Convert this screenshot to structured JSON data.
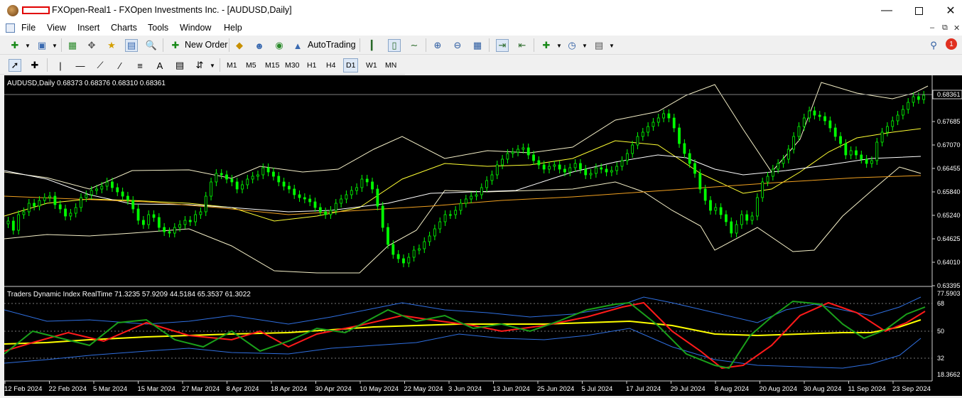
{
  "window": {
    "title": "FXOpen-Real1 - FXOpen Investments Inc. - [AUDUSD,Daily]",
    "minimize_icon": "minimize-icon",
    "maximize_icon": "maximize-icon",
    "close_icon": "close-icon"
  },
  "menu": {
    "items": [
      "File",
      "View",
      "Insert",
      "Charts",
      "Tools",
      "Window",
      "Help"
    ],
    "mdi_minimize": "–",
    "mdi_restore": "⧉",
    "mdi_close": "✕"
  },
  "toolbar1": {
    "new_order": "New Order",
    "auto_trading": "AutoTrading",
    "notification_count": "1"
  },
  "toolbar2": {
    "timeframes": [
      "M1",
      "M5",
      "M15",
      "M30",
      "H1",
      "H4",
      "D1",
      "W1",
      "MN"
    ],
    "active_timeframe": "D1"
  },
  "chart": {
    "header": "AUDUSD,Daily  0.68373 0.68376 0.68310 0.68361",
    "current_price": "0.68361",
    "price_ticks": [
      "0.67685",
      "0.67070",
      "0.66455",
      "0.65840",
      "0.65240",
      "0.64625",
      "0.64010",
      "0.63395"
    ],
    "x_labels": [
      "12 Feb 2024",
      "22 Feb 2024",
      "5 Mar 2024",
      "15 Mar 2024",
      "27 Mar 2024",
      "8 Apr 2024",
      "18 Apr 2024",
      "30 Apr 2024",
      "10 May 2024",
      "22 May 2024",
      "3 Jun 2024",
      "13 Jun 2024",
      "25 Jun 2024",
      "5 Jul 2024",
      "17 Jul 2024",
      "29 Jul 2024",
      "8 Aug 2024",
      "20 Aug 2024",
      "30 Aug 2024",
      "11 Sep 2024",
      "23 Sep 2024"
    ],
    "colors": {
      "background": "#000000",
      "bull_candle": "#00ff00",
      "upper_band": "#f5f0c8",
      "ma_fast": "#ffff33",
      "ma_mid": "#ffffff",
      "ma_slow": "#f0a020"
    }
  },
  "indicator": {
    "header": "Traders Dynamic Index RealTime 71.3235 57.9209 44.5184 65.3537 61.3022",
    "levels": [
      "77.5903",
      "68",
      "50",
      "32",
      "18.3662"
    ],
    "colors": {
      "green_line": "#1aa01a",
      "red_line": "#ff1a1a",
      "yellow_line": "#ffff00",
      "blue_bands": "#2f6fe0"
    }
  }
}
